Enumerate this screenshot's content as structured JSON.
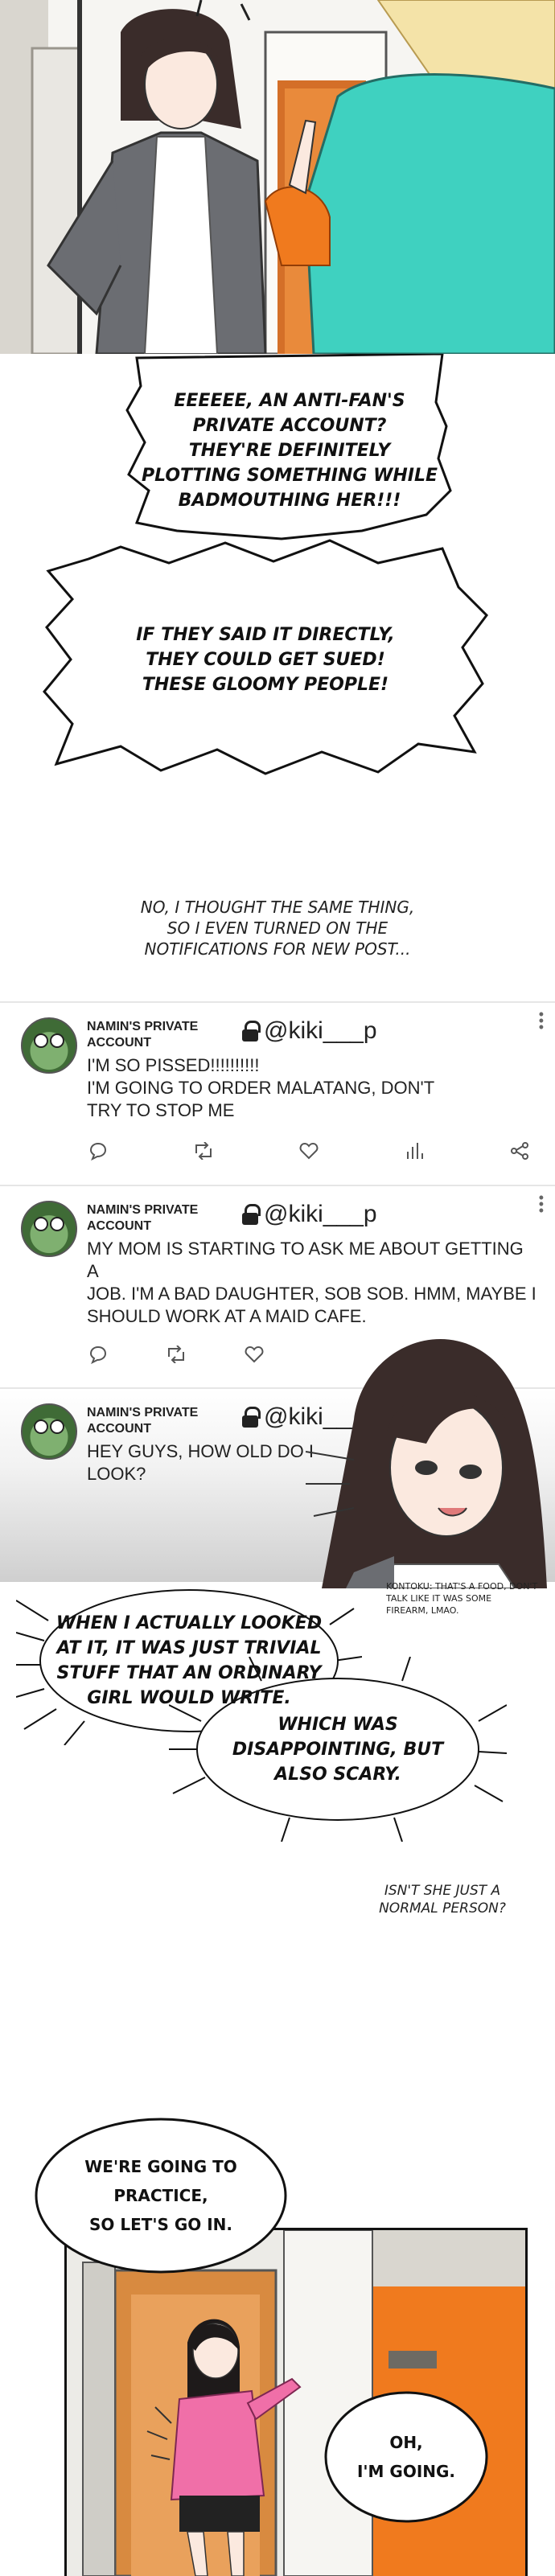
{
  "bubbles": {
    "b1": "EEEEEE, AN ANTI-FAN'S\nPRIVATE ACCOUNT?\nTHEY'RE DEFINITELY\nPLOTTING SOMETHING WHILE\nBADMOUTHING HER!!!",
    "b2": "IF THEY SAID IT DIRECTLY,\nTHEY COULD GET SUED!\nTHESE GLOOMY PEOPLE!",
    "b3": "WHEN I ACTUALLY LOOKED\nAT IT, IT WAS JUST TRIVIAL\nSTUFF THAT AN ORDINARY\nGIRL WOULD WRITE.",
    "b4": "WHICH WAS\nDISAPPOINTING, BUT\nALSO SCARY.",
    "b5": "WE'RE GOING TO\nPRACTICE,\nSO LET'S GO IN.",
    "b6": "OH,\nI'M GOING."
  },
  "narration": {
    "n1": "NO, I THOUGHT THE SAME THING,\nSO I EVEN TURNED ON THE\nNOTIFICATIONS FOR NEW POST...",
    "n2": "ISN'T SHE JUST A\nNORMAL PERSON?",
    "note": "KONTOKU: THAT'S A FOOD, DON'T\nTALK LIKE IT WAS SOME\nFIREARM, LMAO."
  },
  "tweets": [
    {
      "account": "NAMIN'S PRIVATE ACCOUNT",
      "handle": "@kiki___p",
      "body": "I'M SO PISSED!!!!!!!!!!\nI'M GOING TO ORDER MALATANG, DON'T\nTRY TO STOP ME"
    },
    {
      "account": "NAMIN'S PRIVATE ACCOUNT",
      "handle": "@kiki___p",
      "body": "MY MOM IS STARTING TO ASK ME ABOUT GETTING A\nJOB. I'M A BAD DAUGHTER, SOB SOB. HMM, MAYBE I\nSHOULD WORK AT A MAID CAFE."
    },
    {
      "account": "NAMIN'S PRIVATE ACCOUNT",
      "handle": "@kiki___",
      "body": "HEY GUYS, HOW OLD DO I\nLOOK?"
    }
  ],
  "icons": [
    "reply-icon",
    "retweet-icon",
    "like-icon",
    "views-icon",
    "share-icon",
    "lock-icon",
    "more-icon"
  ],
  "colors": {
    "teal": "#3fd1c0",
    "orange": "#f07a1e",
    "jacket_grey": "#6b6d72",
    "hoodie_pink": "#f06fa8",
    "tweet_bg": "#ffffff"
  }
}
